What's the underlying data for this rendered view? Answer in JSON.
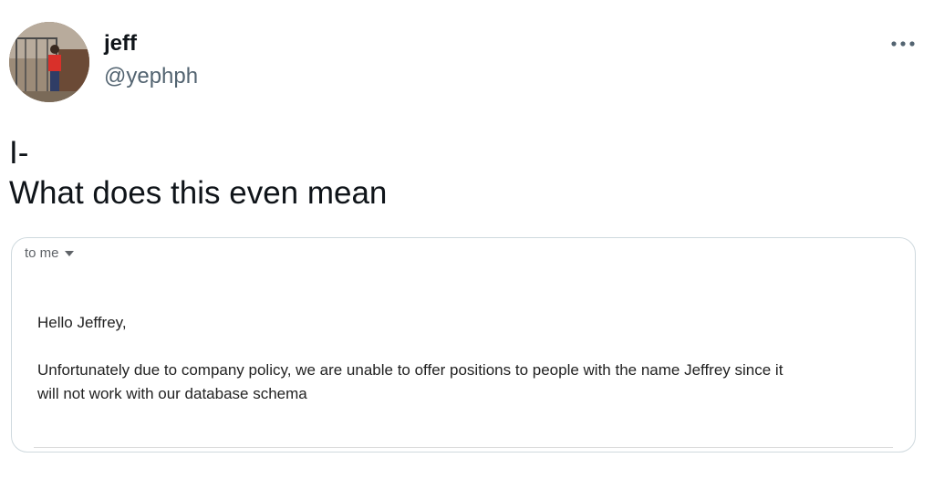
{
  "author": {
    "display_name": "jeff",
    "handle": "@yephph"
  },
  "icons": {
    "avatar": "profile-photo",
    "more": "more-options-icon",
    "dropdown": "caret-down-icon"
  },
  "tweet": {
    "line1": "I-",
    "line2": "What does this even mean"
  },
  "email": {
    "recipient_label": "to me",
    "greeting": "Hello Jeffrey,",
    "body_line1": "Unfortunately due to company policy, we are unable to offer positions to people with the name Jeffrey since it",
    "body_line2": "will not work with our database schema"
  },
  "colors": {
    "text_primary": "#0f1419",
    "text_secondary": "#536471",
    "border": "#cfd9de"
  }
}
